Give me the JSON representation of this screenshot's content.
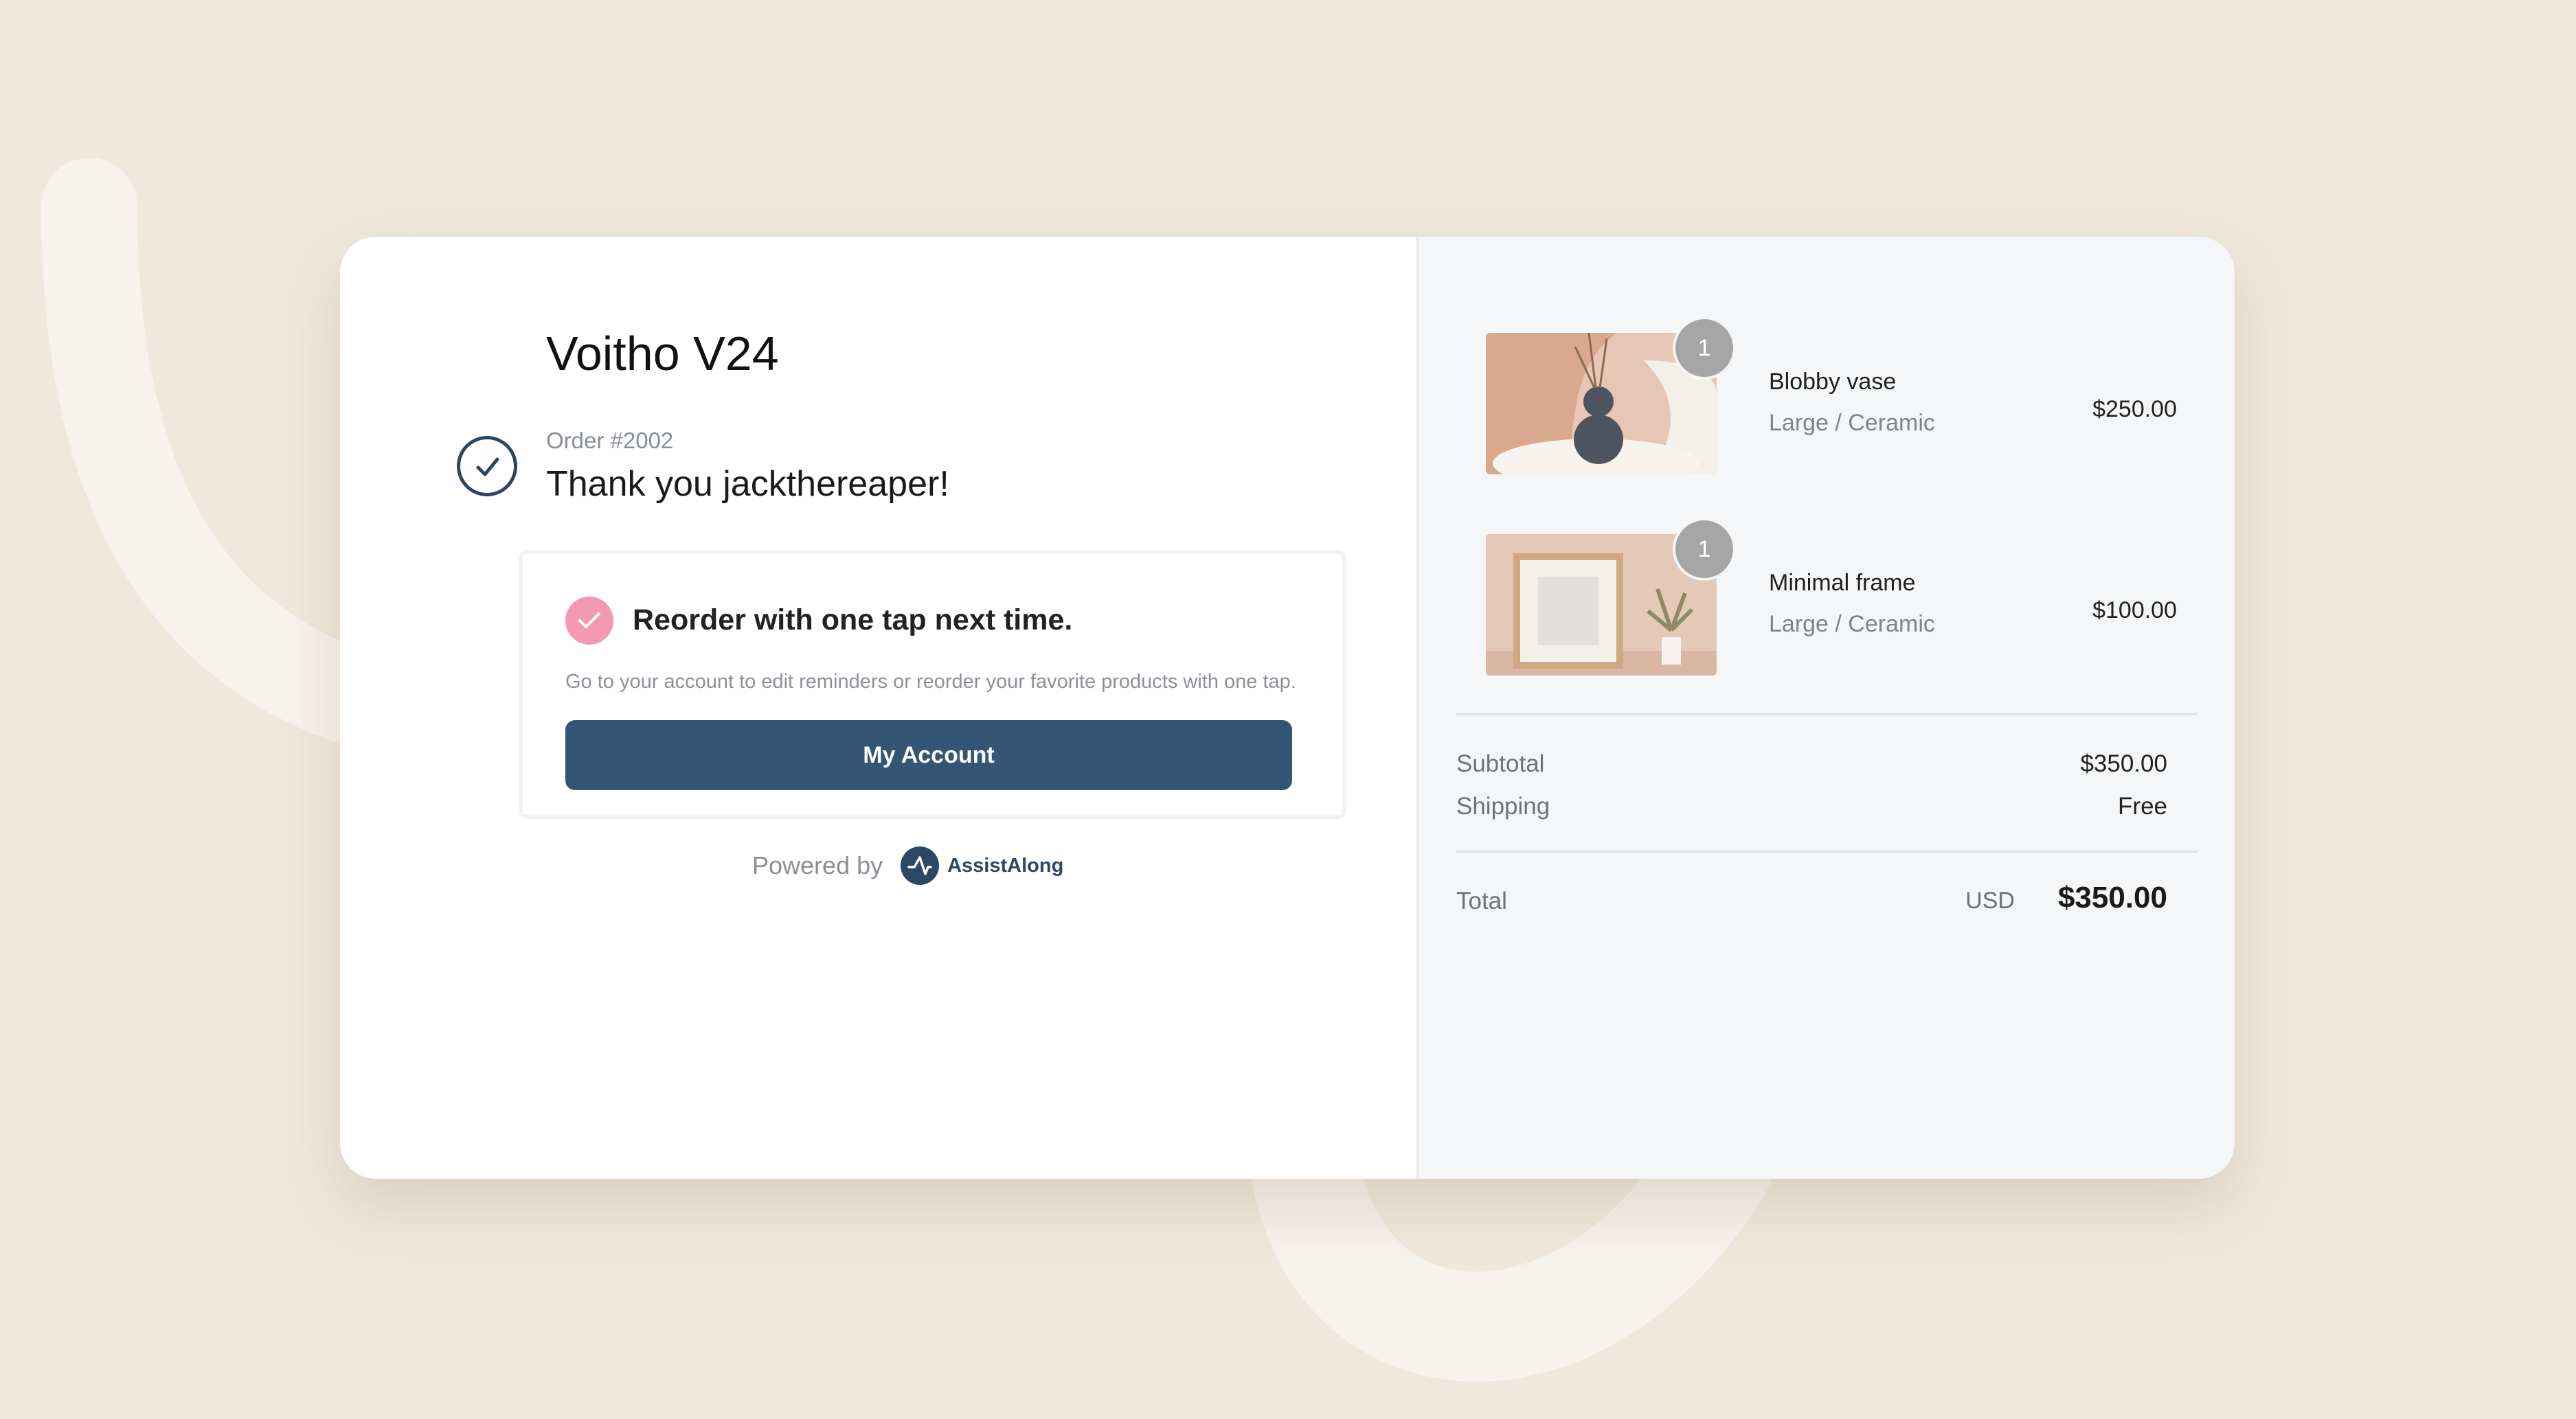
{
  "shop": {
    "title": "Voitho V24"
  },
  "order": {
    "number": "Order #2002",
    "thank_you": "Thank you jackthereaper!"
  },
  "reorder": {
    "heading": "Reorder with one tap next time.",
    "description": "Go to your account to edit reminders or reorder your favorite products with one tap.",
    "button_label": "My Account"
  },
  "powered": {
    "label": "Powered by",
    "brand": "AssistAlong"
  },
  "items": [
    {
      "name": "Blobby vase",
      "variant": "Large / Ceramic",
      "price": "$250.00",
      "quantity": "1"
    },
    {
      "name": "Minimal frame",
      "variant": "Large / Ceramic",
      "price": "$100.00",
      "quantity": "1"
    }
  ],
  "summary": {
    "subtotal_label": "Subtotal",
    "subtotal_value": "$350.00",
    "shipping_label": "Shipping",
    "shipping_value": "Free",
    "total_label": "Total",
    "total_currency": "USD",
    "total_value": "$350.00"
  },
  "colors": {
    "background": "#efe8dc",
    "button": "#345674",
    "accent_pink": "#f49ab0",
    "brand": "#2d4866"
  }
}
